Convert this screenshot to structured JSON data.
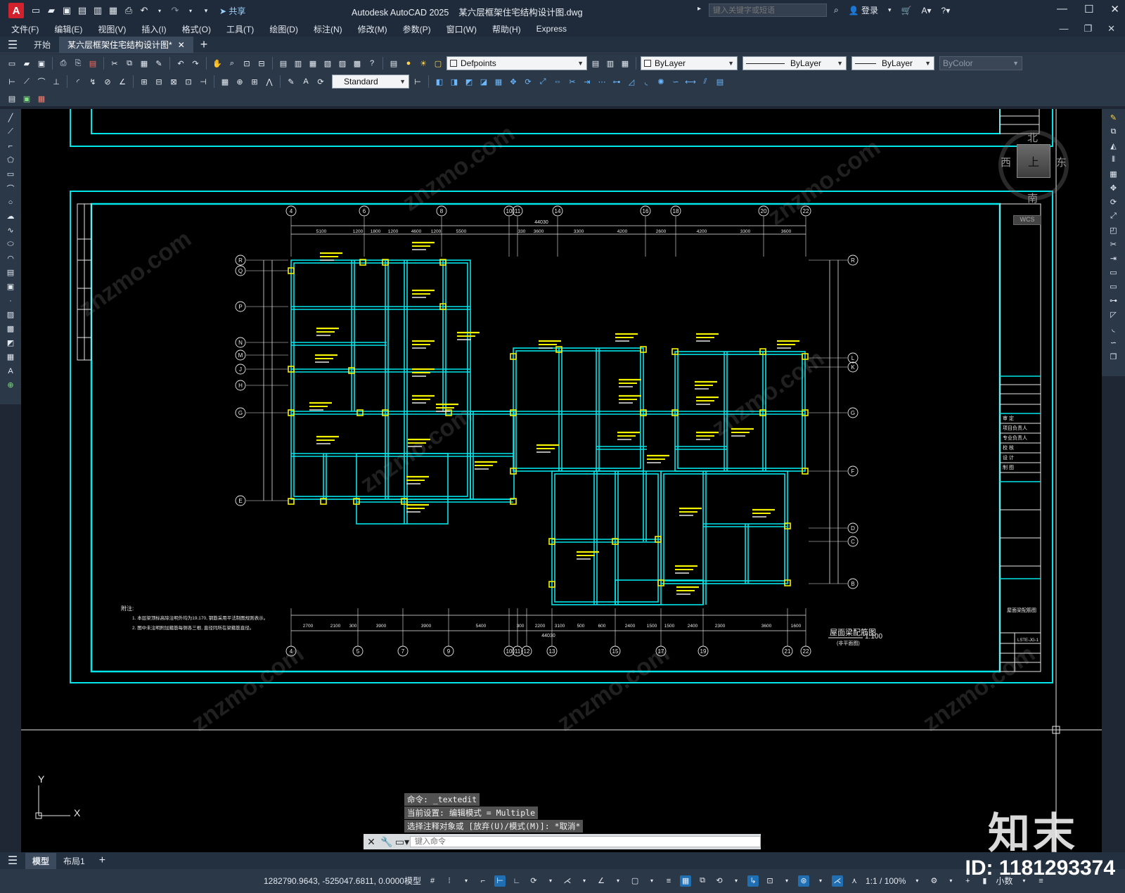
{
  "titlebar": {
    "app_letter": "A",
    "share_label": "共享",
    "app_name": "Autodesk AutoCAD 2025",
    "file_name": "某六层框架住宅结构设计图.dwg",
    "search_placeholder": "键入关键字或短语",
    "login_label": "登录"
  },
  "menu": {
    "items": [
      "文件(F)",
      "编辑(E)",
      "视图(V)",
      "插入(I)",
      "格式(O)",
      "工具(T)",
      "绘图(D)",
      "标注(N)",
      "修改(M)",
      "参数(P)",
      "窗口(W)",
      "帮助(H)",
      "Express"
    ]
  },
  "tabs": {
    "start": "开始",
    "document": "某六层框架住宅结构设计图*"
  },
  "toolbar": {
    "layer_name": "Defpoints",
    "text_style": "Standard",
    "color": "ByLayer",
    "linetype": "ByLayer",
    "lineweight": "ByLayer",
    "plotstyle": "ByColor"
  },
  "viewcube": {
    "north": "北",
    "south": "南",
    "east": "东",
    "west": "西",
    "top": "上",
    "wcs": "WCS"
  },
  "drawing": {
    "top_axes": [
      "4",
      "6",
      "8",
      "10",
      "11",
      "14",
      "16",
      "18",
      "20",
      "22"
    ],
    "bottom_axes": [
      "4",
      "5",
      "7",
      "9",
      "10",
      "11",
      "12",
      "13",
      "15",
      "17",
      "19",
      "21",
      "22"
    ],
    "left_axes": [
      "R",
      "Q",
      "P",
      "N",
      "M",
      "J",
      "H",
      "G",
      "E"
    ],
    "right_axes": [
      "R",
      "L",
      "K",
      "G",
      "F",
      "D",
      "C",
      "B"
    ],
    "top_dims": [
      "5100",
      "1200",
      "1800",
      "1200",
      "4600",
      "1200",
      "5500",
      "330",
      "3600",
      "3300",
      "4200",
      "2600",
      "4200",
      "3300",
      "3600"
    ],
    "bottom_dims": [
      "2700",
      "2100",
      "300",
      "3900",
      "3900",
      "5400",
      "300",
      "2200",
      "3100",
      "500",
      "600",
      "2400",
      "1500",
      "1500",
      "2400",
      "2300",
      "3600",
      "1600"
    ],
    "overall_dim": "44030",
    "plan_title": "屋面梁配筋图",
    "plan_subtitle": "(非平面图)",
    "scale": "1:100",
    "notes_title": "附注:",
    "notes": [
      "1. 本层梁顶标高除注明外均为19.170, 钢筋采用平法制图规则表示。",
      "2. 图中未注明附加箍筋每侧各三根, 直径同所在梁箍筋直径。"
    ],
    "title_block": {
      "rows": [
        "审 定",
        "项目负责人",
        "专业负责人",
        "校 核",
        "设 计",
        "制 图"
      ],
      "sheet_name": "屋面梁配筋图",
      "sheet_number": "LSTE-JG-1"
    }
  },
  "command": {
    "history": [
      "命令: _textedit",
      "当前设置: 编辑模式 = Multiple",
      "选择注释对象或 [放弃(U)/模式(M)]: *取消*"
    ],
    "placeholder": "键入命令"
  },
  "layouts": {
    "model": "模型",
    "layout1": "布局1"
  },
  "status": {
    "coordinates": "1282790.9643, -525047.6811, 0.0000",
    "mode": "模型",
    "annotation_scale": "1:1 / 100%",
    "units": "小数"
  },
  "watermark": {
    "site": "znzmo.com",
    "brand": "知末",
    "id": "ID: 1181293374"
  }
}
